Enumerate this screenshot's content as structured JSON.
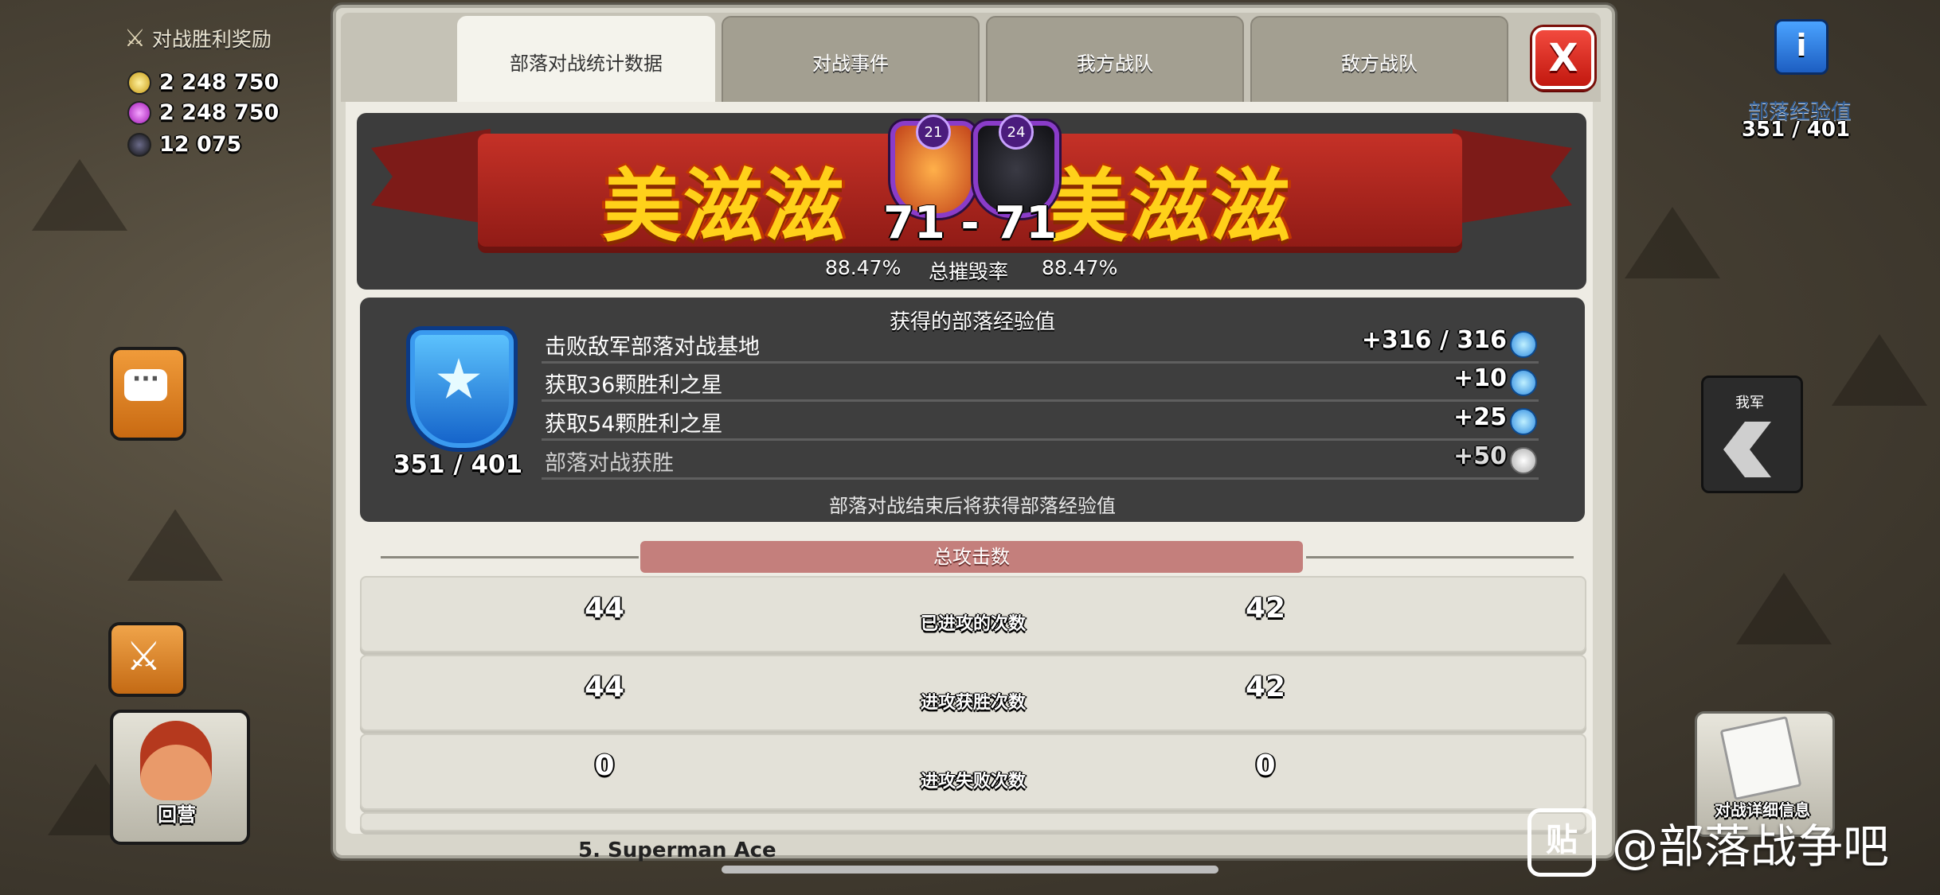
{
  "hud_left": {
    "war_reward_label": "对战胜利奖励",
    "gold": "2 248 750",
    "elixir": "2 248 750",
    "dark_elixir": "12 075"
  },
  "tabs": [
    {
      "label": "部落对战统计数据",
      "active": true
    },
    {
      "label": "对战事件",
      "active": false
    },
    {
      "label": "我方战队",
      "active": false
    },
    {
      "label": "敌方战队",
      "active": false
    }
  ],
  "close_label": "X",
  "banner": {
    "left_clan": "美滋滋",
    "right_clan": "美滋滋",
    "left_level": "21",
    "right_level": "24",
    "score": "71 - 71",
    "left_pct": "88.47%",
    "right_pct": "88.47%",
    "pct_label": "总摧毁率"
  },
  "xp": {
    "title": "获得的部落经验值",
    "total": "351 / 401",
    "rows": [
      {
        "label": "击败敌军部落对战基地",
        "value": "+316 / 316"
      },
      {
        "label": "获取36颗胜利之星",
        "value": "+10"
      },
      {
        "label": "获取54颗胜利之星",
        "value": "+25"
      },
      {
        "label": "部落对战获胜",
        "value": "+50"
      }
    ],
    "note": "部落对战结束后将获得部落经验值"
  },
  "attacks": {
    "header": "总攻击数",
    "rows": [
      {
        "label": "已进攻的次数",
        "left": "44",
        "right": "42"
      },
      {
        "label": "进攻获胜次数",
        "left": "44",
        "right": "42"
      },
      {
        "label": "进攻失败次数",
        "left": "0",
        "right": "0"
      }
    ]
  },
  "hud_right": {
    "info_label": "i",
    "clan_xp_label": "部落经验值",
    "clan_xp_value": "351 / 401",
    "nav_label": "我军",
    "details_label": "对战详细信息"
  },
  "home_label": "回营",
  "watermark": {
    "icon": "贴",
    "text": "@部落战争吧"
  },
  "peek_text": "5. Superman Ace"
}
